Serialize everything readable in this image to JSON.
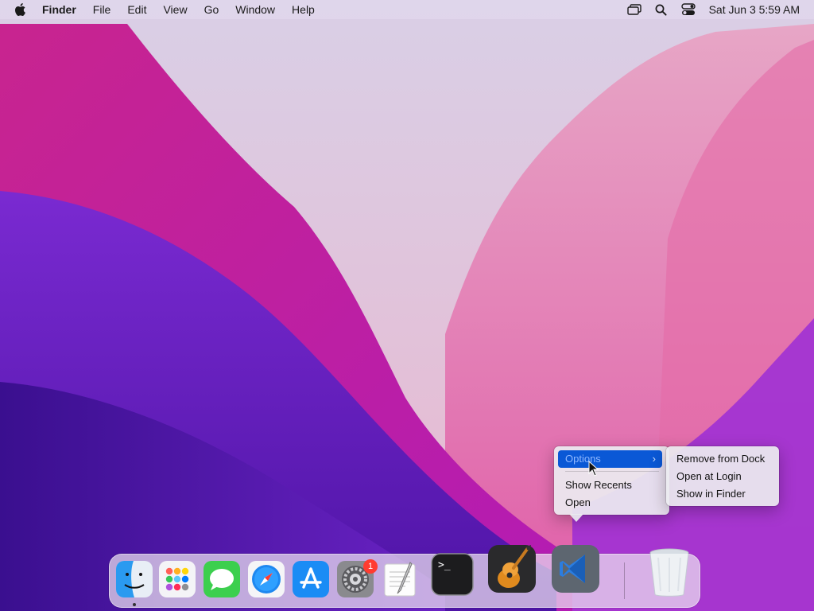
{
  "menubar": {
    "app_name": "Finder",
    "items": [
      "File",
      "Edit",
      "View",
      "Go",
      "Window",
      "Help"
    ],
    "status_icons": [
      "screen-mirroring-icon",
      "search-icon",
      "control-center-icon"
    ],
    "clock": "Sat Jun 3  5:59 AM"
  },
  "context_menu": {
    "items": [
      {
        "label": "Options",
        "has_submenu": true,
        "highlighted": true
      },
      {
        "label": "Show Recents"
      },
      {
        "label": "Open"
      }
    ],
    "submenu": {
      "items": [
        "Remove from Dock",
        "Open at Login",
        "Show in Finder"
      ]
    }
  },
  "dock": {
    "apps": [
      {
        "name": "Finder",
        "icon": "finder-icon",
        "running": true
      },
      {
        "name": "Launchpad",
        "icon": "launchpad-icon"
      },
      {
        "name": "Messages",
        "icon": "messages-icon"
      },
      {
        "name": "Safari",
        "icon": "safari-icon"
      },
      {
        "name": "App Store",
        "icon": "app-store-icon"
      },
      {
        "name": "System Preferences",
        "icon": "system-preferences-icon",
        "badge": "1"
      },
      {
        "name": "TextEdit",
        "icon": "textedit-icon"
      },
      {
        "name": "Terminal",
        "icon": "terminal-icon"
      },
      {
        "name": "GarageBand",
        "icon": "garageband-icon"
      },
      {
        "name": "Visual Studio Code",
        "icon": "vscode-icon"
      }
    ],
    "trash": {
      "name": "Trash",
      "icon": "trash-icon"
    },
    "terminal_prompt": ">_"
  },
  "colors": {
    "menu_highlight": "#0a58d6",
    "badge": "#ff3b30"
  }
}
